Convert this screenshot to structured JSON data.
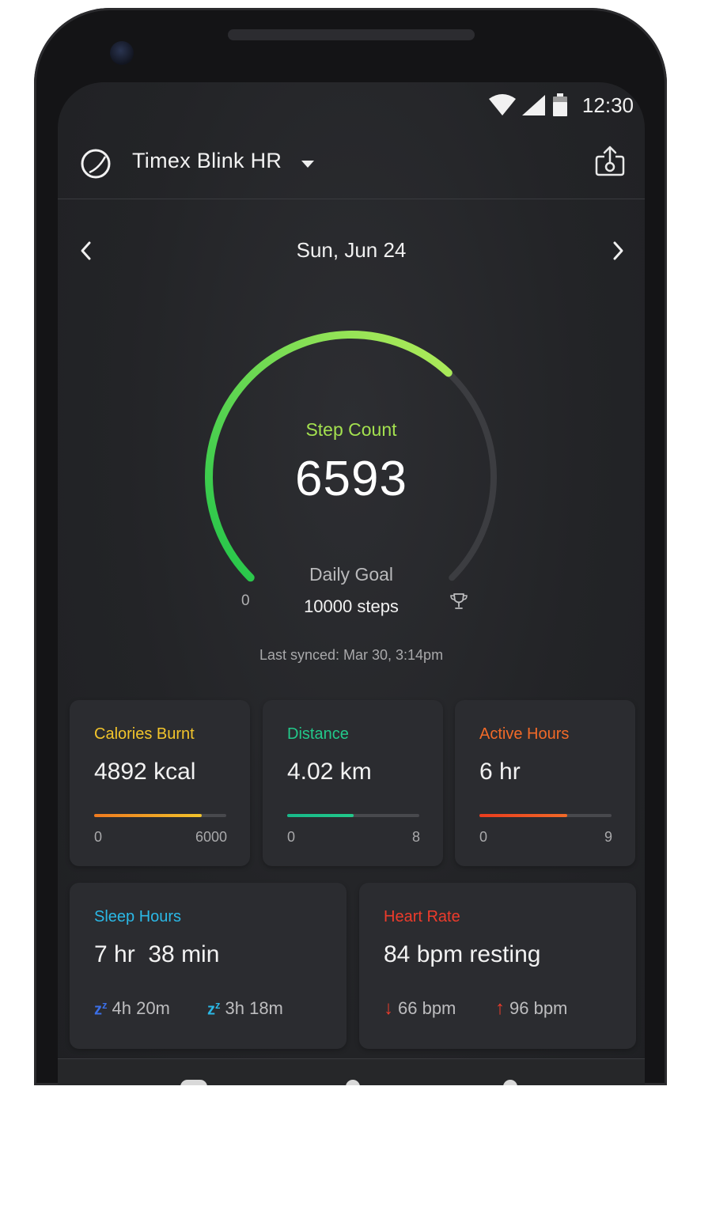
{
  "status": {
    "time": "12:30"
  },
  "header": {
    "device_name": "Timex Blink HR"
  },
  "date": {
    "label": "Sun, Jun 24"
  },
  "steps": {
    "title": "Step Count",
    "value": "6593",
    "goal_label": "Daily Goal",
    "goal_value": "10000 steps",
    "min_label": "0",
    "progress": 0.6593
  },
  "last_synced": "Last synced: Mar 30, 3:14pm",
  "cards": {
    "calories": {
      "title": "Calories Burnt",
      "value": "4892 kcal",
      "min": "0",
      "max": "6000",
      "progress": 0.8153,
      "color": "#f2c42b"
    },
    "distance": {
      "title": "Distance",
      "value": "4.02 km",
      "min": "0",
      "max": "8",
      "progress": 0.5025,
      "color": "#22c98a"
    },
    "active": {
      "title": "Active Hours",
      "value": "6 hr",
      "min": "0",
      "max": "9",
      "progress": 0.6667,
      "color": "#f26a28"
    },
    "sleep": {
      "title": "Sleep Hours",
      "value": "7 hr  38 min",
      "deep": "4h 20m",
      "light": "3h 18m",
      "color": "#2bb8e6"
    },
    "heart": {
      "title": "Heart Rate",
      "value": "84 bpm resting",
      "low": "66 bpm",
      "high": "96 bpm",
      "color": "#ee3b2b"
    }
  },
  "colors": {
    "gauge_start": "#1fc44a",
    "gauge_end": "#b4ec5a",
    "gauge_track": "#3c3d41",
    "calories_bar_start": "#f07a1f",
    "distance_bar_start": "#18b98a",
    "active_bar_start": "#ea3c1e"
  }
}
